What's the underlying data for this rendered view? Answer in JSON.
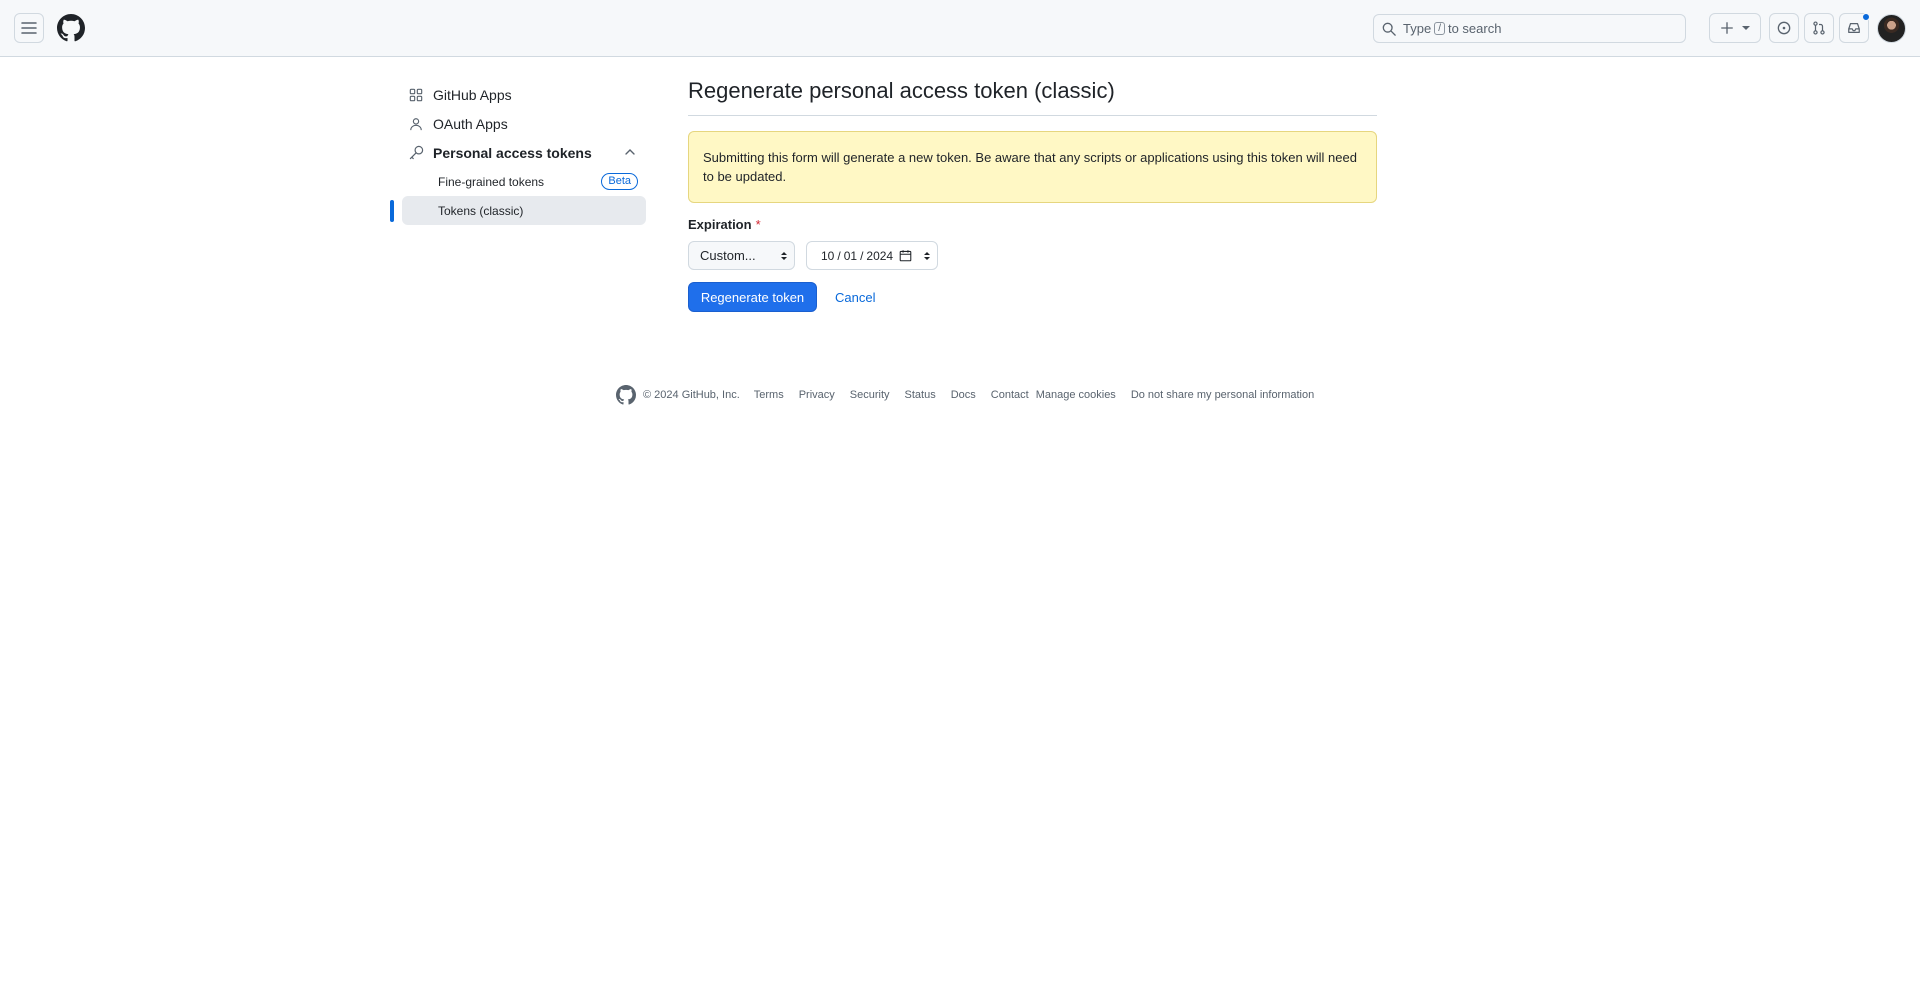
{
  "header": {
    "menu_icon": "hamburger-icon",
    "logo_icon": "github-mark-icon",
    "search": {
      "text_before": "Type",
      "shortcut": "/",
      "text_after": "to search"
    },
    "create_icon": "plus-icon",
    "issues_icon": "issue-opened-icon",
    "pr_icon": "git-pull-request-icon",
    "inbox_icon": "inbox-icon"
  },
  "sidebar": {
    "items": [
      {
        "label": "GitHub Apps",
        "icon": "apps-icon"
      },
      {
        "label": "OAuth Apps",
        "icon": "person-icon"
      },
      {
        "label": "Personal access tokens",
        "icon": "key-icon"
      }
    ],
    "subitems": [
      {
        "label": "Fine-grained tokens",
        "badge": "Beta"
      },
      {
        "label": "Tokens (classic)"
      }
    ]
  },
  "main": {
    "title": "Regenerate personal access token (classic)",
    "flash": "Submitting this form will generate a new token. Be aware that any scripts or applications using this token will need to be updated.",
    "expiration_label": "Expiration",
    "required_mark": "*",
    "expiration_select": "Custom...",
    "date": {
      "month": "10",
      "day": "01",
      "year": "2024",
      "separator": "/"
    },
    "submit_label": "Regenerate token",
    "cancel_label": "Cancel"
  },
  "footer": {
    "copyright": "© 2024 GitHub, Inc.",
    "links": [
      "Terms",
      "Privacy",
      "Security",
      "Status",
      "Docs",
      "Contact",
      "Manage cookies",
      "Do not share my personal information"
    ]
  },
  "colors": {
    "accent": "#0969da",
    "primary_button": "#1f6feb",
    "flash_background": "#fff8c5",
    "required": "#d1242f"
  }
}
